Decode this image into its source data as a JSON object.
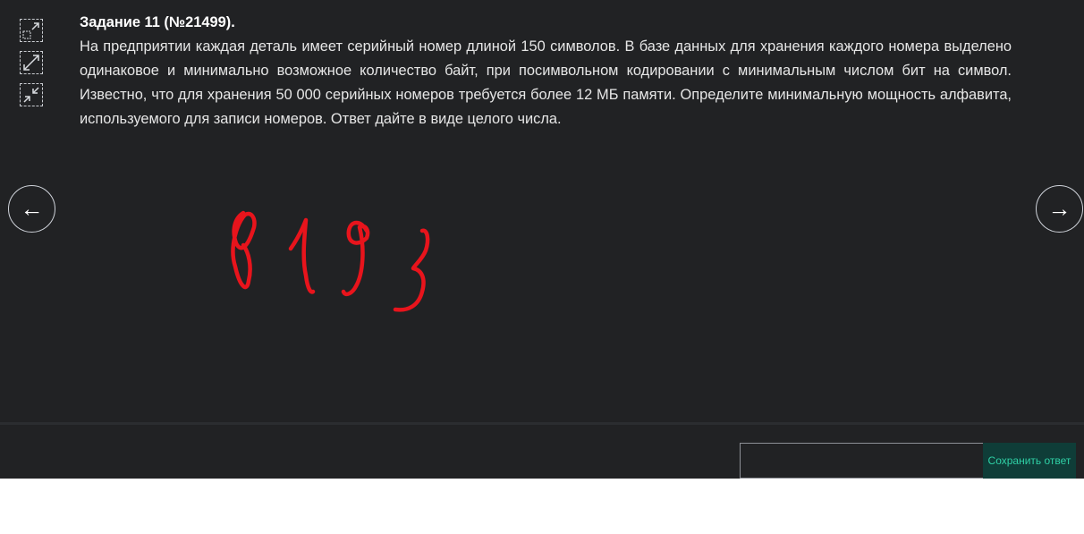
{
  "task": {
    "title": "Задание 11 (№21499).",
    "text": "На предприятии каждая деталь имеет серийный номер длиной 150 символов. В базе данных для хранения каждого номера выделено одинаковое и минимально возможное количество байт, при посимвольном кодировании с минимальным числом бит на символ. Известно, что для хранения 50 000 серийных номеров требуется более 12 МБ памяти. Определите минимальную мощность алфавита, используемого для записи номеров. Ответ дайте в виде целого числа."
  },
  "toolbar": {
    "icons": [
      "collapse-expand-icon",
      "expand-icon",
      "shrink-icon"
    ]
  },
  "navigation": {
    "prev_label": "←",
    "next_label": "→"
  },
  "handwritten_answer": "8193",
  "answer": {
    "value": "",
    "placeholder": "",
    "save_label": "Сохранить ответ"
  },
  "colors": {
    "panel_bg": "#212224",
    "text": "#e6e6e6",
    "ink": "#e8141c",
    "save_bg": "#0f3d38",
    "save_text": "#2fd1a6"
  }
}
